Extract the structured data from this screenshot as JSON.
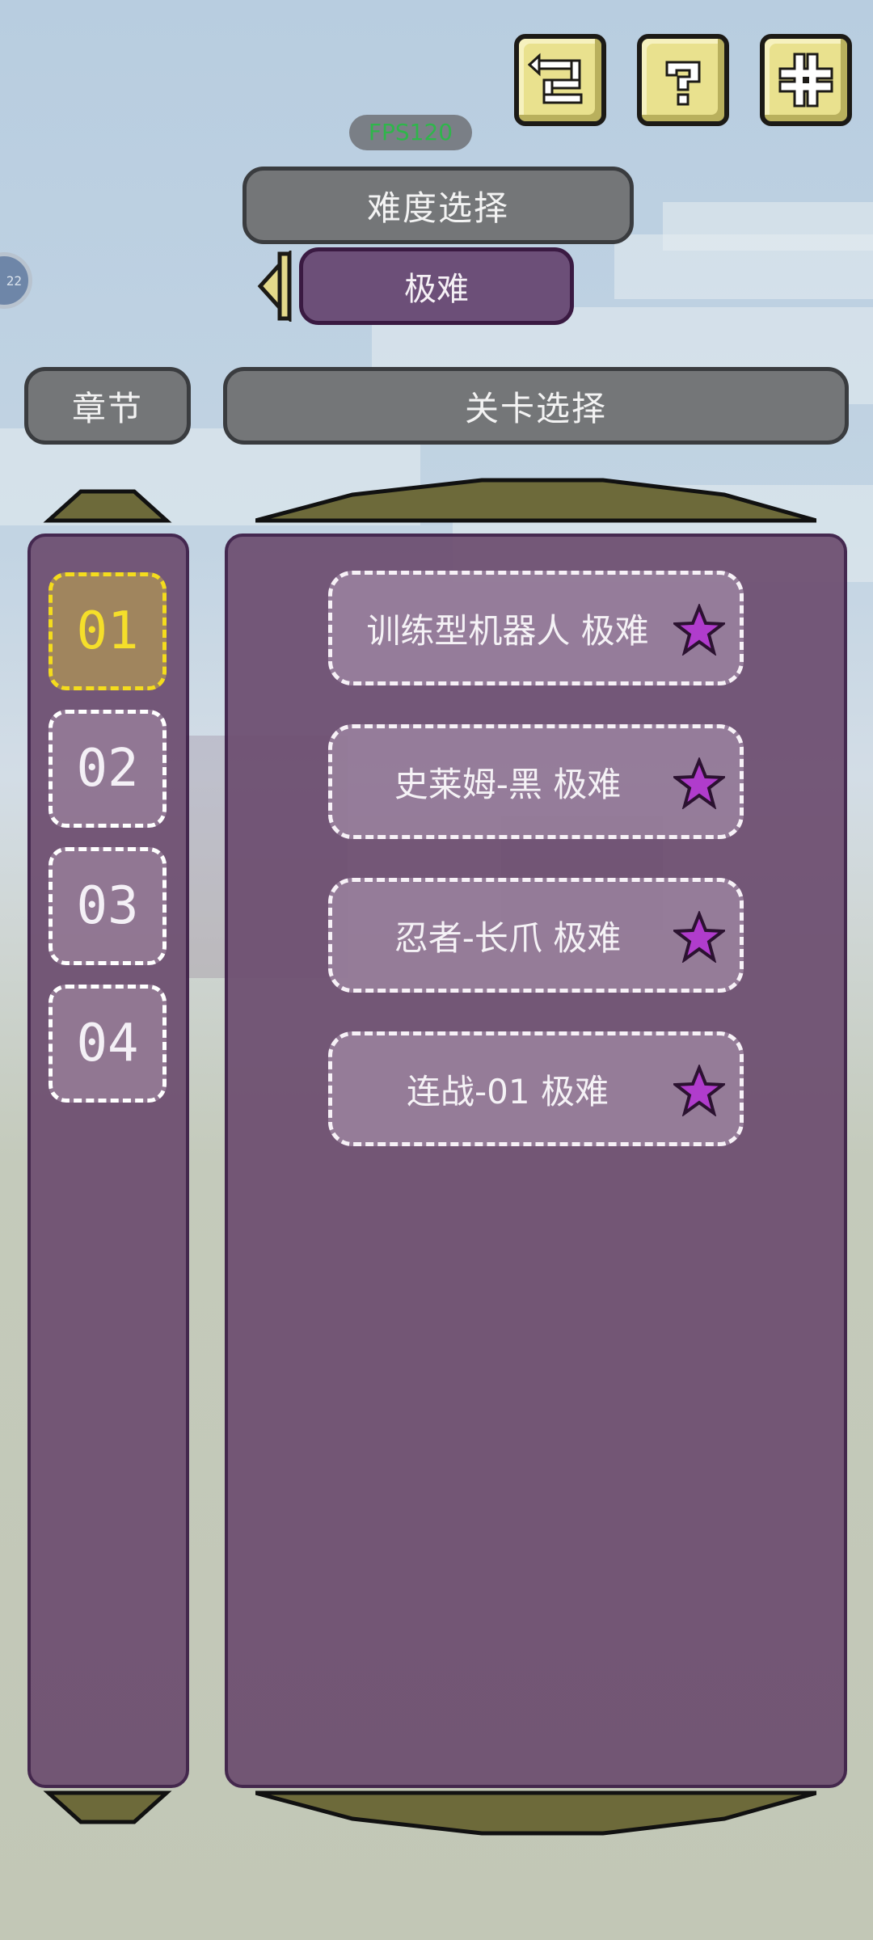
{
  "toolbar": {
    "buttons": [
      {
        "icon": "refresh-icon"
      },
      {
        "icon": "help-icon",
        "label": "?"
      },
      {
        "icon": "settings-icon"
      }
    ]
  },
  "fps": "FPS120",
  "difficulty": {
    "title": "难度选择",
    "current": "极难"
  },
  "chapters": {
    "header": "章节",
    "items": [
      "01",
      "02",
      "03",
      "04"
    ],
    "selected": "01"
  },
  "levels": {
    "header": "关卡选择",
    "items": [
      {
        "name": "训练型机器人 极难",
        "star": "purple-star-icon"
      },
      {
        "name": "史莱姆-黑 极难",
        "star": "purple-star-icon"
      },
      {
        "name": "忍者-长爪 极难",
        "star": "purple-star-icon"
      },
      {
        "name": "连战-01 极难",
        "star": "purple-star-icon"
      }
    ]
  },
  "colors": {
    "panel": "#6d4e70",
    "button_yellow": "#e9e18e",
    "selected_chapter": "#f4dc1d",
    "star": "#b03ccc"
  }
}
